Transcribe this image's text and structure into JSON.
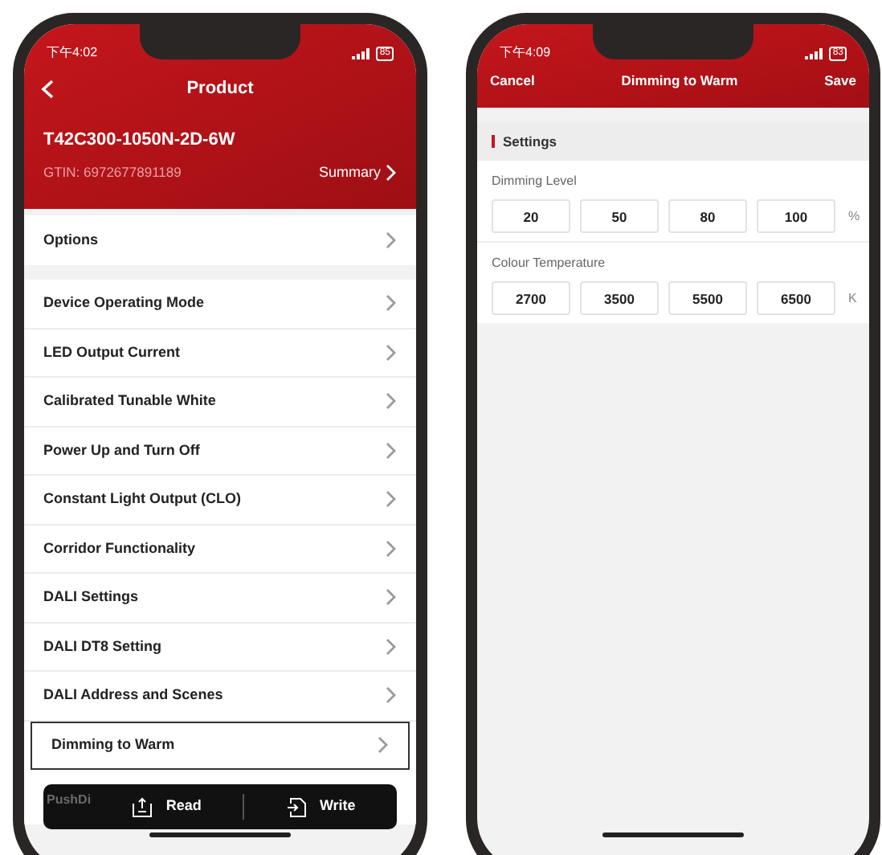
{
  "left_phone": {
    "status_bar": {
      "time": "下午4:02",
      "battery": "85"
    },
    "header": {
      "title": "Product",
      "product_name": "T42C300-1050N-2D-6W",
      "gtin": "GTIN: 6972677891189",
      "summary_link": "Summary"
    },
    "options_row": {
      "label": "Options"
    },
    "menu_items": [
      {
        "label": "Device Operating Mode",
        "selected": false
      },
      {
        "label": "LED Output Current",
        "selected": false
      },
      {
        "label": "Calibrated Tunable White",
        "selected": false
      },
      {
        "label": "Power Up and Turn Off",
        "selected": false
      },
      {
        "label": "Constant Light Output (CLO)",
        "selected": false
      },
      {
        "label": "Corridor Functionality",
        "selected": false
      },
      {
        "label": "DALI Settings",
        "selected": false
      },
      {
        "label": "DALI DT8 Setting",
        "selected": false
      },
      {
        "label": "DALI Address and Scenes",
        "selected": false
      },
      {
        "label": "Dimming to Warm",
        "selected": true
      },
      {
        "label": "PushDi",
        "selected": false
      }
    ],
    "action_bar": {
      "read": "Read",
      "write": "Write"
    }
  },
  "right_phone": {
    "status_bar": {
      "time": "下午4:09",
      "battery": "83"
    },
    "nav": {
      "cancel": "Cancel",
      "title": "Dimming to Warm",
      "save": "Save"
    },
    "section": {
      "title": "Settings"
    },
    "fields": [
      {
        "label": "Dimming Level",
        "values": [
          "20",
          "50",
          "80",
          "100"
        ],
        "unit": "%"
      },
      {
        "label": "Colour Temperature",
        "values": [
          "2700",
          "3500",
          "5500",
          "6500"
        ],
        "unit": "K"
      }
    ]
  }
}
